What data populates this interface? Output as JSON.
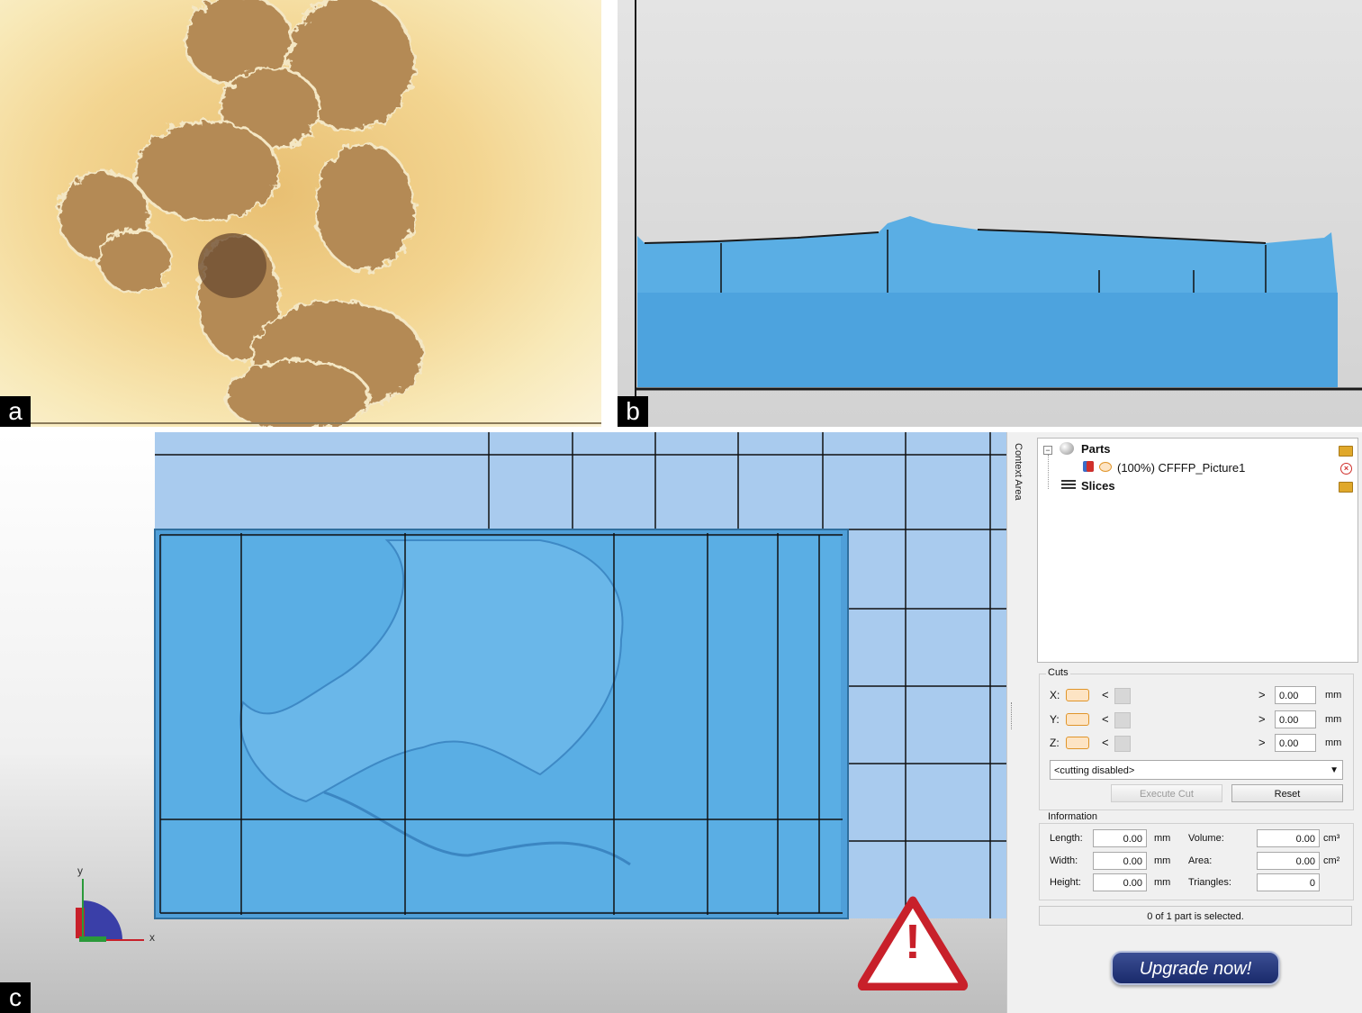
{
  "panels": {
    "a": {
      "label": "a"
    },
    "b": {
      "label": "b"
    },
    "c": {
      "label": "c"
    }
  },
  "sidebar_tab": {
    "label": "Context Area"
  },
  "tree": {
    "parts_label": "Parts",
    "part_item": "(100%) CFFFP_Picture1",
    "slices_label": "Slices"
  },
  "cuts": {
    "title": "Cuts",
    "rows": [
      {
        "axis": "X:",
        "value": "0.00",
        "unit": "mm"
      },
      {
        "axis": "Y:",
        "value": "0.00",
        "unit": "mm"
      },
      {
        "axis": "Z:",
        "value": "0.00",
        "unit": "mm"
      }
    ],
    "arrow_left": "<",
    "arrow_right": ">",
    "mode": "<cutting disabled>",
    "execute_label": "Execute Cut",
    "reset_label": "Reset"
  },
  "information": {
    "title": "Information",
    "length_label": "Length:",
    "length_value": "0.00",
    "length_unit": "mm",
    "width_label": "Width:",
    "width_value": "0.00",
    "width_unit": "mm",
    "height_label": "Height:",
    "height_value": "0.00",
    "height_unit": "mm",
    "volume_label": "Volume:",
    "volume_value": "0.00",
    "volume_unit": "cm³",
    "area_label": "Area:",
    "area_value": "0.00",
    "area_unit": "cm²",
    "triangles_label": "Triangles:",
    "triangles_value": "0"
  },
  "status": "0 of 1 part is selected.",
  "upgrade_label": "Upgrade now!",
  "axes_widget": {
    "y_label": "y",
    "x_label": "x"
  },
  "warning_icon": {
    "glyph": "!"
  },
  "colors": {
    "model_blue": "#5aaee4",
    "grid_blue": "#a9cbee",
    "upgrade_blue": "#24357a",
    "warning_red": "#c8202a"
  }
}
